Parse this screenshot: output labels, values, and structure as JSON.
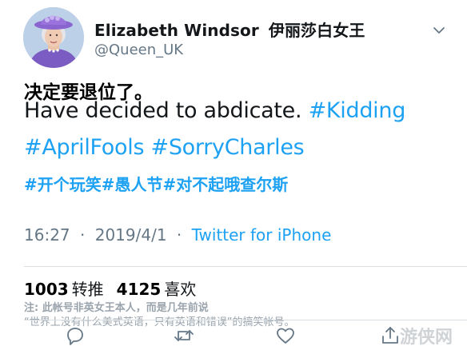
{
  "user": {
    "name": "Elizabeth Windsor",
    "name_zh": "伊丽莎白女王",
    "handle": "@Queen_UK"
  },
  "tweet": {
    "line1": "决定要退位了。",
    "text_en": "Have decided to abdicate.",
    "hashtags": [
      "#Kidding",
      "#AprilFools",
      "#SorryCharles"
    ],
    "hashtags_zh": "#开个玩笑#愚人节#对不起哦查尔斯"
  },
  "meta": {
    "time": "16:27",
    "separator": "·",
    "date": "2019/4/1",
    "source": "Twitter for iPhone"
  },
  "stats": {
    "retweets": "1003",
    "retweets_label": "转推",
    "likes": "4125",
    "likes_label": "喜欢"
  },
  "note": {
    "line1": "注: 此帐号非英女王本人，而是几年前说",
    "line2": "“世界上没有什么美式英语，只有英语和错误”的搞笑帐号。"
  },
  "watermark": "游侠网",
  "colors": {
    "link": "#1da1f2",
    "secondary_text": "#657786",
    "icon": "#657786"
  },
  "icons": [
    "chevron-down-icon",
    "reply-icon",
    "retweet-icon",
    "like-icon",
    "share-icon"
  ]
}
